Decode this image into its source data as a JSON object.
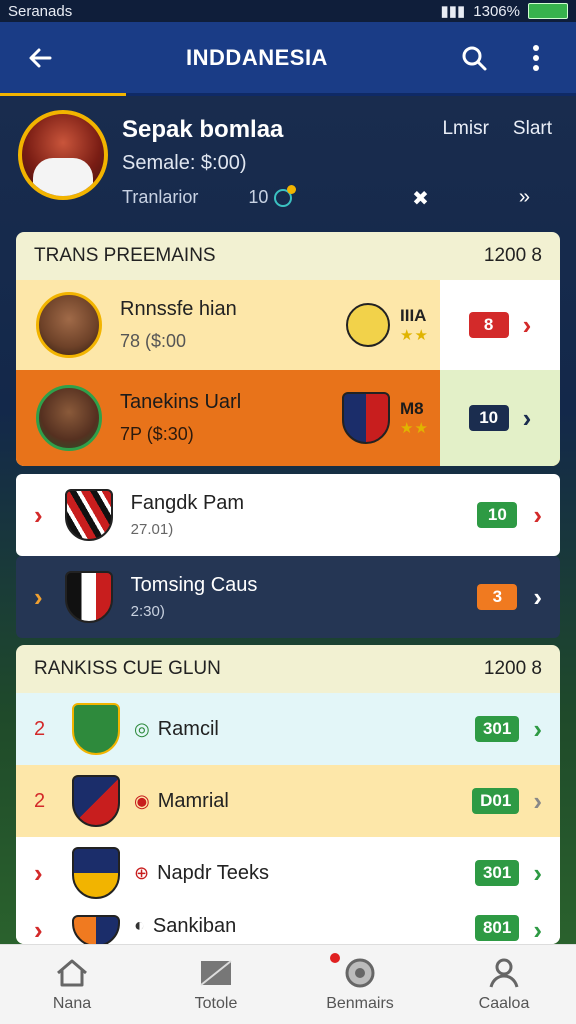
{
  "status_bar": {
    "carrier": "Seranads",
    "right": "1306%"
  },
  "app_bar": {
    "title": "INDDANESIA"
  },
  "profile": {
    "name": "Sepak bomlaa",
    "subtitle": "Semale: $:00)",
    "meta_label": "Tranlarior",
    "meta_value": "10",
    "link_1": "Lmisr",
    "link_2": "Slart"
  },
  "transfers": {
    "title": "TRANS PREEMAINS",
    "count": "1200 8",
    "items": [
      {
        "name": "Rnnssfe hian",
        "price": "78 ($:00",
        "club": "IIIA",
        "badge": "8",
        "badge_color": "#d32a2a"
      },
      {
        "name": "Tanekins Uarl",
        "price": "7P ($:30)",
        "club": "M8",
        "badge": "10",
        "badge_color": "#1b2d4f"
      }
    ]
  },
  "clubs": [
    {
      "name": "Fangdk Pam",
      "sub": "27.01)",
      "badge": "10",
      "badge_color": "#2e9a44"
    },
    {
      "name": "Tomsing Caus",
      "sub": "2:30)",
      "badge": "3",
      "badge_color": "#f07a20"
    }
  ],
  "ranking": {
    "title": "RANKISS CUE GLUN",
    "count": "1200 8",
    "items": [
      {
        "rank": "2",
        "name": "Ramcil",
        "badge": "301"
      },
      {
        "rank": "2",
        "name": "Mamrial",
        "badge": "D01"
      },
      {
        "rank": "",
        "name": "Napdr Teeks",
        "badge": "301"
      },
      {
        "rank": "",
        "name": "Sankiban",
        "badge": "801"
      }
    ]
  },
  "bottom_nav": [
    {
      "label": "Nana",
      "icon": "home-icon"
    },
    {
      "label": "Totole",
      "icon": "mail-icon"
    },
    {
      "label": "Benmairs",
      "icon": "ball-icon"
    },
    {
      "label": "Caaloa",
      "icon": "user-icon"
    }
  ],
  "colors": {
    "accent": "#f2b400",
    "appbar": "#1a3c86",
    "orange_row": "#e8731a"
  }
}
